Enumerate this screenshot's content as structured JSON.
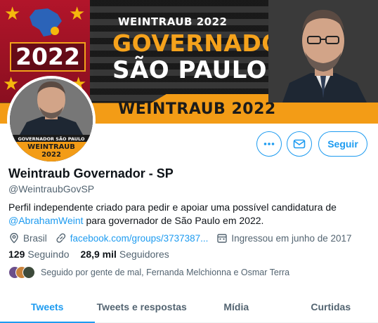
{
  "banner": {
    "year": "2022",
    "name_small": "WEINTRAUB 2022",
    "title_line1": "GOVERNADOR",
    "title_line2": "SÃO PAULO",
    "name_big": "WEINTRAUB 2022",
    "colors": {
      "accent_orange": "#f39c16",
      "flag_red": "#b2152a",
      "star_gold": "#f5b80d"
    }
  },
  "avatar": {
    "line1": "GOVERNADOR SÃO PAULO",
    "line2": "WEINTRAUB",
    "line3": "2022"
  },
  "actions": {
    "more_icon": "more-dots-icon",
    "message_icon": "envelope-icon",
    "follow_label": "Seguir"
  },
  "profile": {
    "display_name": "Weintraub Governador - SP",
    "handle": "@WeintraubGovSP",
    "bio_part1": "Perfil independente criado para pedir e apoiar uma possível candidatura de ",
    "bio_mention": "@AbrahamWeint",
    "bio_part2": " para governador de São Paulo em 2022.",
    "location": "Brasil",
    "link": "facebook.com/groups/3737387...",
    "joined": "Ingressou em junho de 2017"
  },
  "stats": {
    "following_count": "129",
    "following_label": "Seguindo",
    "followers_count": "28,9 mil",
    "followers_label": "Seguidores"
  },
  "followed_by": "Seguido por gente de mal, Fernanda Melchionna e Osmar Terra",
  "tabs": [
    {
      "label": "Tweets"
    },
    {
      "label": "Tweets e respostas"
    },
    {
      "label": "Mídia"
    },
    {
      "label": "Curtidas"
    }
  ],
  "theme": {
    "primary_blue": "#1d9bf0",
    "secondary_text": "#536471"
  }
}
